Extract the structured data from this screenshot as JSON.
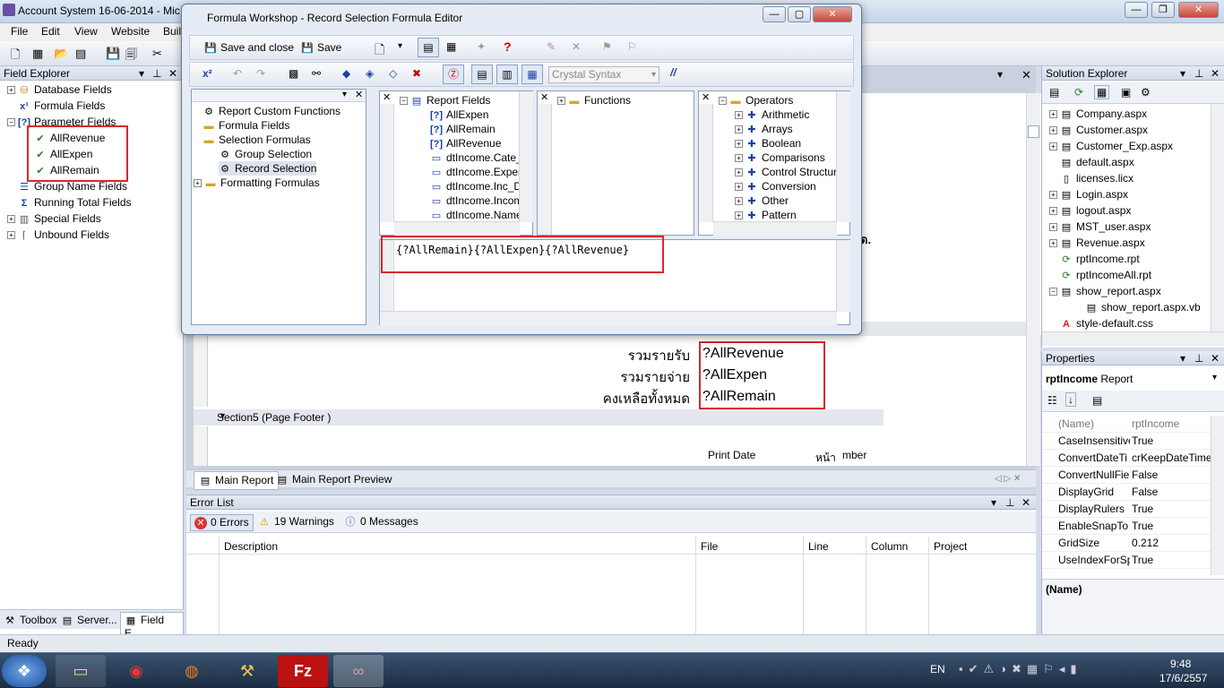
{
  "window": {
    "title": "Account System 16-06-2014 - Mic"
  },
  "menu": [
    "File",
    "Edit",
    "View",
    "Website",
    "Buil"
  ],
  "field_explorer": {
    "title": "Field Explorer",
    "items": [
      {
        "label": "Database Fields",
        "icon": "database-icon"
      },
      {
        "label": "Formula Fields",
        "icon": "formula-icon"
      },
      {
        "label": "Parameter Fields",
        "icon": "parameter-icon"
      },
      {
        "label": "AllRevenue",
        "icon": "parameter-check-icon"
      },
      {
        "label": "AllExpen",
        "icon": "parameter-check-icon"
      },
      {
        "label": "AllRemain",
        "icon": "parameter-check-icon"
      },
      {
        "label": "Group Name Fields",
        "icon": "group-icon"
      },
      {
        "label": "Running Total Fields",
        "icon": "sigma-icon"
      },
      {
        "label": "Special Fields",
        "icon": "special-icon"
      },
      {
        "label": "Unbound Fields",
        "icon": "unbound-icon"
      }
    ],
    "bottom_tabs": [
      "Toolbox",
      "Server...",
      "Field E..."
    ]
  },
  "dialog": {
    "title": "Formula Workshop - Record Selection Formula Editor",
    "save_close": "Save and close",
    "save": "Save",
    "syntax": "Crystal Syntax",
    "comment_btn": "//",
    "tree": [
      "Report Custom Functions",
      "Formula Fields",
      "Selection Formulas",
      "Group Selection",
      "Record Selection",
      "Formatting Formulas"
    ],
    "report_fields_title": "Report Fields",
    "report_fields": [
      "AllExpen",
      "AllRemain",
      "AllRevenue",
      "dtIncome.Cate_",
      "dtIncome.Exper",
      "dtIncome.Inc_D",
      "dtIncome.Incom",
      "dtIncome.Name"
    ],
    "functions_title": "Functions",
    "operators_title": "Operators",
    "operators": [
      "Arithmetic",
      "Arrays",
      "Boolean",
      "Comparisons",
      "Control Structure",
      "Conversion",
      "Other",
      "Pattern"
    ],
    "formula_text": "{?AllRemain}{?AllExpen}{?AllRevenue}"
  },
  "report": {
    "labels": [
      "รวมรายรับ",
      "รวมรายจ่าย",
      "คงเหลือทั้งหมด"
    ],
    "fields": [
      "?AllRevenue",
      "?AllExpen",
      "?AllRemain"
    ],
    "section_footer": "Section5 (Page Footer )",
    "print_date": "Print Date",
    "page_label": "หน้า",
    "page_number": "mber",
    "partial_text": "ด.",
    "tabs": [
      "Main Report",
      "Main Report Preview"
    ]
  },
  "error_list": {
    "title": "Error List",
    "errors": "0 Errors",
    "warnings": "19 Warnings",
    "messages": "0 Messages",
    "columns": [
      "Description",
      "File",
      "Line",
      "Column",
      "Project"
    ]
  },
  "solution_explorer": {
    "title": "Solution Explorer",
    "items": [
      "Company.aspx",
      "Customer.aspx",
      "Customer_Exp.aspx",
      "default.aspx",
      "licenses.licx",
      "Login.aspx",
      "logout.aspx",
      "MST_user.aspx",
      "Revenue.aspx",
      "rptIncome.rpt",
      "rptIncomeAll.rpt",
      "show_report.aspx",
      "show_report.aspx.vb",
      "style-default.css"
    ]
  },
  "properties": {
    "title": "Properties",
    "object": "rptIncome",
    "object_type": "Report",
    "rows": [
      {
        "k": "(Name)",
        "v": "rptIncome"
      },
      {
        "k": "CaseInsensitive",
        "v": "True"
      },
      {
        "k": "ConvertDateTi",
        "v": "crKeepDateTime"
      },
      {
        "k": "ConvertNullFie",
        "v": "False"
      },
      {
        "k": "DisplayGrid",
        "v": "False"
      },
      {
        "k": "DisplayRulers",
        "v": "True"
      },
      {
        "k": "EnableSnapTo",
        "v": "True"
      },
      {
        "k": "GridSize",
        "v": "0.212"
      },
      {
        "k": "UseIndexForSp",
        "v": "True"
      }
    ],
    "footer": "(Name)"
  },
  "status": "Ready",
  "tray": {
    "lang": "EN",
    "time": "9:48",
    "date": "17/6/2557"
  }
}
